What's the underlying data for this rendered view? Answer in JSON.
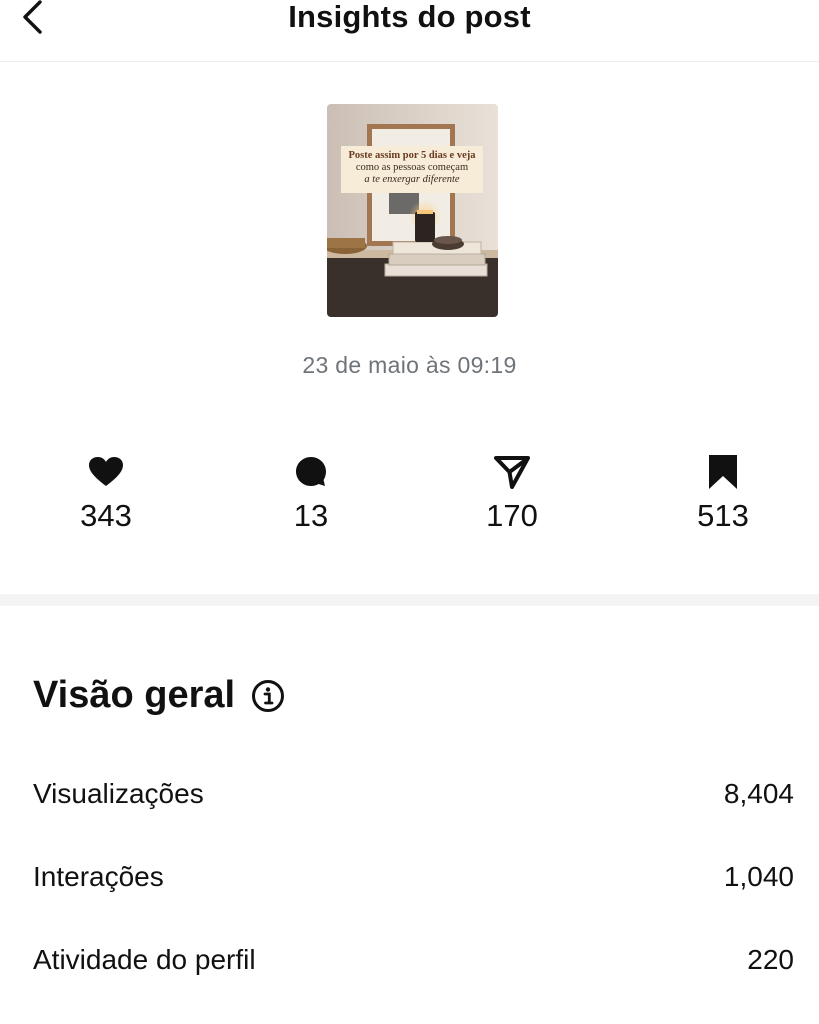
{
  "header": {
    "title": "Insights do post",
    "back_icon": "chevron-left-icon"
  },
  "post": {
    "thumbnail_caption": {
      "line1": "Poste assim por 5 dias e veja",
      "line2": "como as pessoas começam",
      "line3": "a te enxergar diferente"
    },
    "date": "23 de maio às 09:19"
  },
  "metrics": [
    {
      "icon": "heart-icon",
      "value": "343"
    },
    {
      "icon": "comment-icon",
      "value": "13"
    },
    {
      "icon": "share-icon",
      "value": "170"
    },
    {
      "icon": "bookmark-icon",
      "value": "513"
    }
  ],
  "overview": {
    "title": "Visão geral",
    "info_icon": "info-icon",
    "rows": [
      {
        "label": "Visualizações",
        "value": "8,404"
      },
      {
        "label": "Interações",
        "value": "1,040"
      },
      {
        "label": "Atividade do perfil",
        "value": "220"
      }
    ]
  },
  "colors": {
    "text": "#111111",
    "muted": "#6f7479",
    "divider": "#f4f4f4"
  }
}
